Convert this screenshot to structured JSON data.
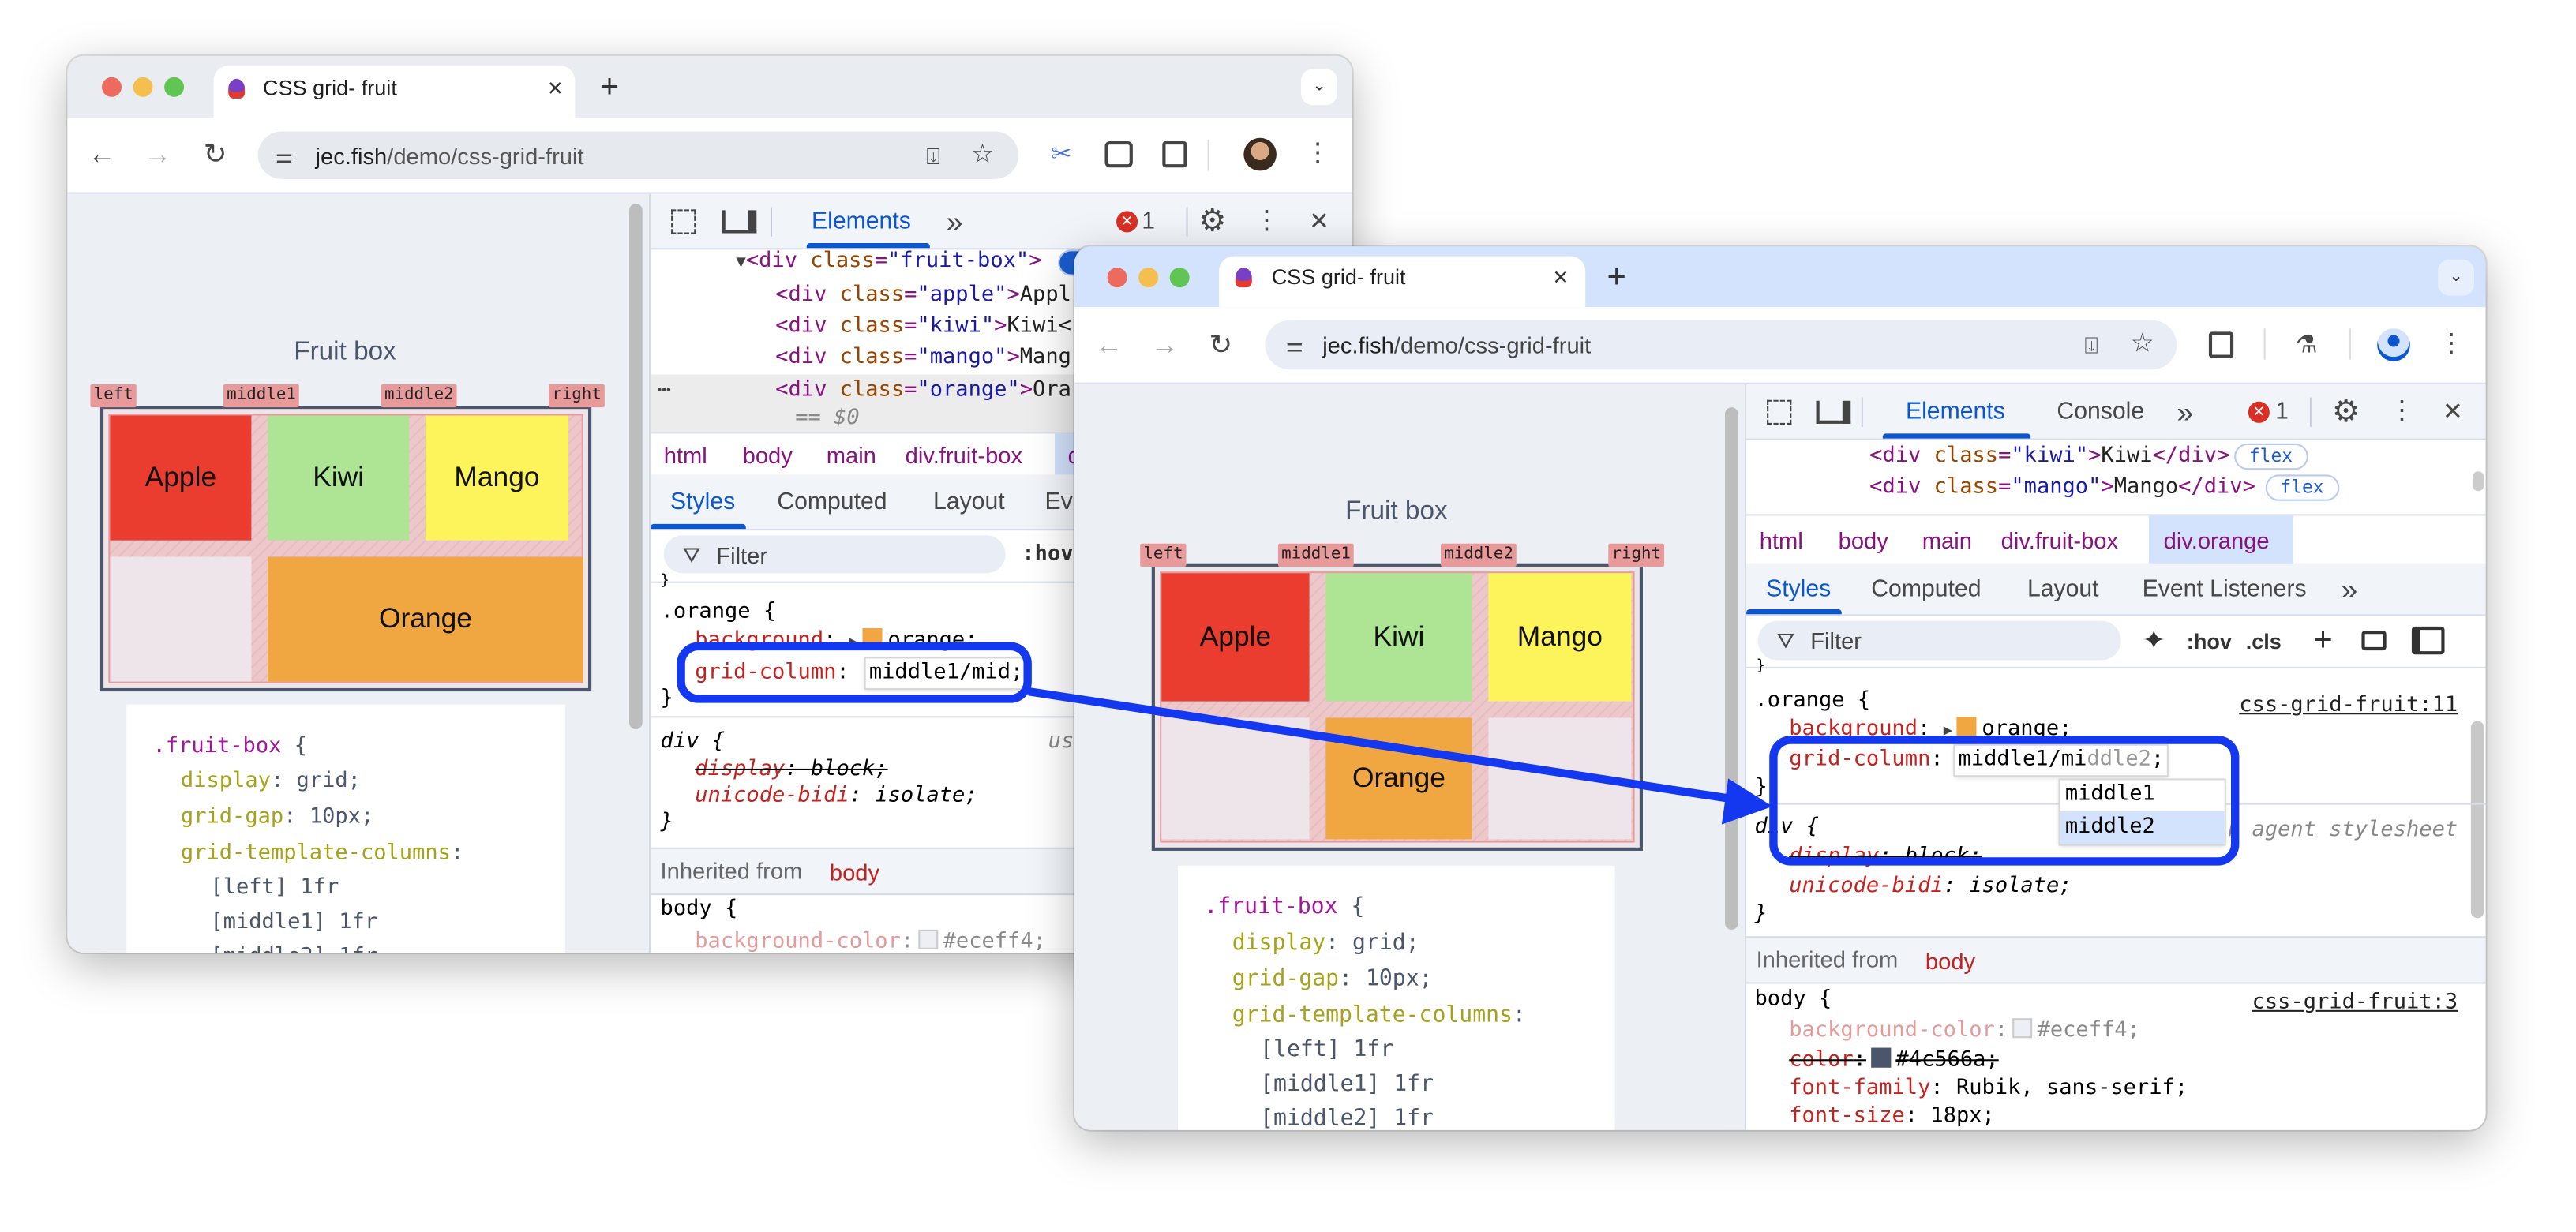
{
  "page": {
    "heading": "Fruit box",
    "line_names": {
      "left": "left",
      "middle1": "middle1",
      "middle2": "middle2",
      "right": "right"
    },
    "cells": {
      "apple": "Apple",
      "kiwi": "Kiwi",
      "mango": "Mango",
      "orange": "Orange"
    },
    "cell_colors": {
      "apple": "#ea3c2f",
      "kiwi": "#ade595",
      "mango": "#fdf45c",
      "orange": "#f0a742"
    },
    "code": {
      "selector": ".fruit-box",
      "open": "{",
      "lines": [
        {
          "prop": "display",
          "colon": ":",
          "value": "grid;"
        },
        {
          "prop": "grid-gap",
          "colon": ":",
          "value": "10px;"
        },
        {
          "prop": "grid-template-columns",
          "colon": ":",
          "value": ""
        }
      ],
      "columns": [
        "[left] 1fr",
        "[middle1] 1fr",
        "[middle2] 1fr"
      ]
    }
  },
  "dom_syntax": {
    "open": "<div",
    "attr": "class",
    "eq": "=",
    "gt": ">"
  },
  "window1": {
    "tab_title": "CSS grid- fruit",
    "url_host": "jec.fish",
    "url_path": "/demo/css-grid-fruit",
    "devtools": {
      "tabs": {
        "elements": "Elements",
        "more": "»"
      },
      "error_count": "1",
      "dom": [
        {
          "value": "\"fruit-box\"",
          "text": "",
          "badge": "g"
        },
        {
          "value": "\"apple\"",
          "text": "Appl"
        },
        {
          "value": "\"kiwi\"",
          "text": "Kiwi<"
        },
        {
          "value": "\"mango\"",
          "text": "Mang"
        },
        {
          "value": "\"orange\"",
          "text": "Ora"
        }
      ],
      "ellipsis": "•••",
      "selected_marker": "== $0",
      "breadcrumb": [
        "html",
        "body",
        "main",
        "div.fruit-box",
        "d"
      ],
      "panel_tabs": [
        "Styles",
        "Computed",
        "Layout",
        "Ev"
      ],
      "filter_placeholder": "Filter",
      "hov": ":hov",
      "styles": {
        "prev_close": "}",
        "rule1": {
          "selector": ".orange",
          "open": "{",
          "close": "}",
          "decls": [
            {
              "prop": "background",
              "value": "orange;"
            },
            {
              "prop": "grid-column",
              "value": "middle1/mid",
              "semi": ";"
            }
          ]
        },
        "rule2": {
          "selector": "div",
          "open": "{",
          "close": "}",
          "source": "us",
          "decls": [
            {
              "prop": "display",
              "value": "block;"
            },
            {
              "prop": "unicode-bidi",
              "value": "isolate;"
            }
          ]
        },
        "inherited_label": "Inherited from",
        "inherited_from": "body",
        "rule3": {
          "selector": "body",
          "open": "{",
          "decls": [
            {
              "prop": "background-color",
              "value": "#eceff4;"
            }
          ]
        }
      }
    }
  },
  "window2": {
    "tab_title": "CSS grid- fruit",
    "url_host": "jec.fish",
    "url_path": "/demo/css-grid-fruit",
    "devtools": {
      "tabs": {
        "elements": "Elements",
        "console": "Console",
        "more": "»"
      },
      "error_count": "1",
      "dom": [
        {
          "value": "\"kiwi\"",
          "text": "Kiwi",
          "close": "</div>",
          "badge": "flex"
        },
        {
          "value": "\"mango\"",
          "text": "Mango",
          "close": "</div>",
          "badge": "flex"
        }
      ],
      "breadcrumb": [
        "html",
        "body",
        "main",
        "div.fruit-box",
        "div.orange"
      ],
      "panel_tabs": [
        "Styles",
        "Computed",
        "Layout",
        "Event Listeners",
        "»"
      ],
      "filter_placeholder": "Filter",
      "hov": ":hov",
      "cls": ".cls",
      "styles": {
        "prev_close": "}",
        "rule1": {
          "selector": ".orange",
          "open": "{",
          "close": "}",
          "source": "css-grid-fruit:11",
          "decls": [
            {
              "prop": "background",
              "value": "orange;"
            },
            {
              "prop": "grid-column",
              "value": "middle1/mi",
              "ghost": "ddle2",
              "semi": ";"
            }
          ]
        },
        "autocomplete": {
          "options": [
            "middle1",
            "middle2"
          ],
          "selected": "middle2"
        },
        "rule2": {
          "selector": "div",
          "open": "{",
          "close": "}",
          "source": "user agent stylesheet",
          "decls": [
            {
              "prop": "display",
              "value": "block;"
            },
            {
              "prop": "unicode-bidi",
              "value": "isolate;"
            }
          ]
        },
        "inherited_label": "Inherited from",
        "inherited_from": "body",
        "rule3": {
          "selector": "body",
          "open": "{",
          "source": "css-grid-fruit:3",
          "decls": [
            {
              "prop": "background-color",
              "value": "#eceff4;"
            },
            {
              "prop": "color",
              "value": "#4c566a;"
            },
            {
              "prop": "font-family",
              "value": "Rubik, sans-serif;"
            },
            {
              "prop": "font-size",
              "value": "18px;"
            }
          ]
        }
      }
    }
  },
  "annotation_color": "#1437f0"
}
